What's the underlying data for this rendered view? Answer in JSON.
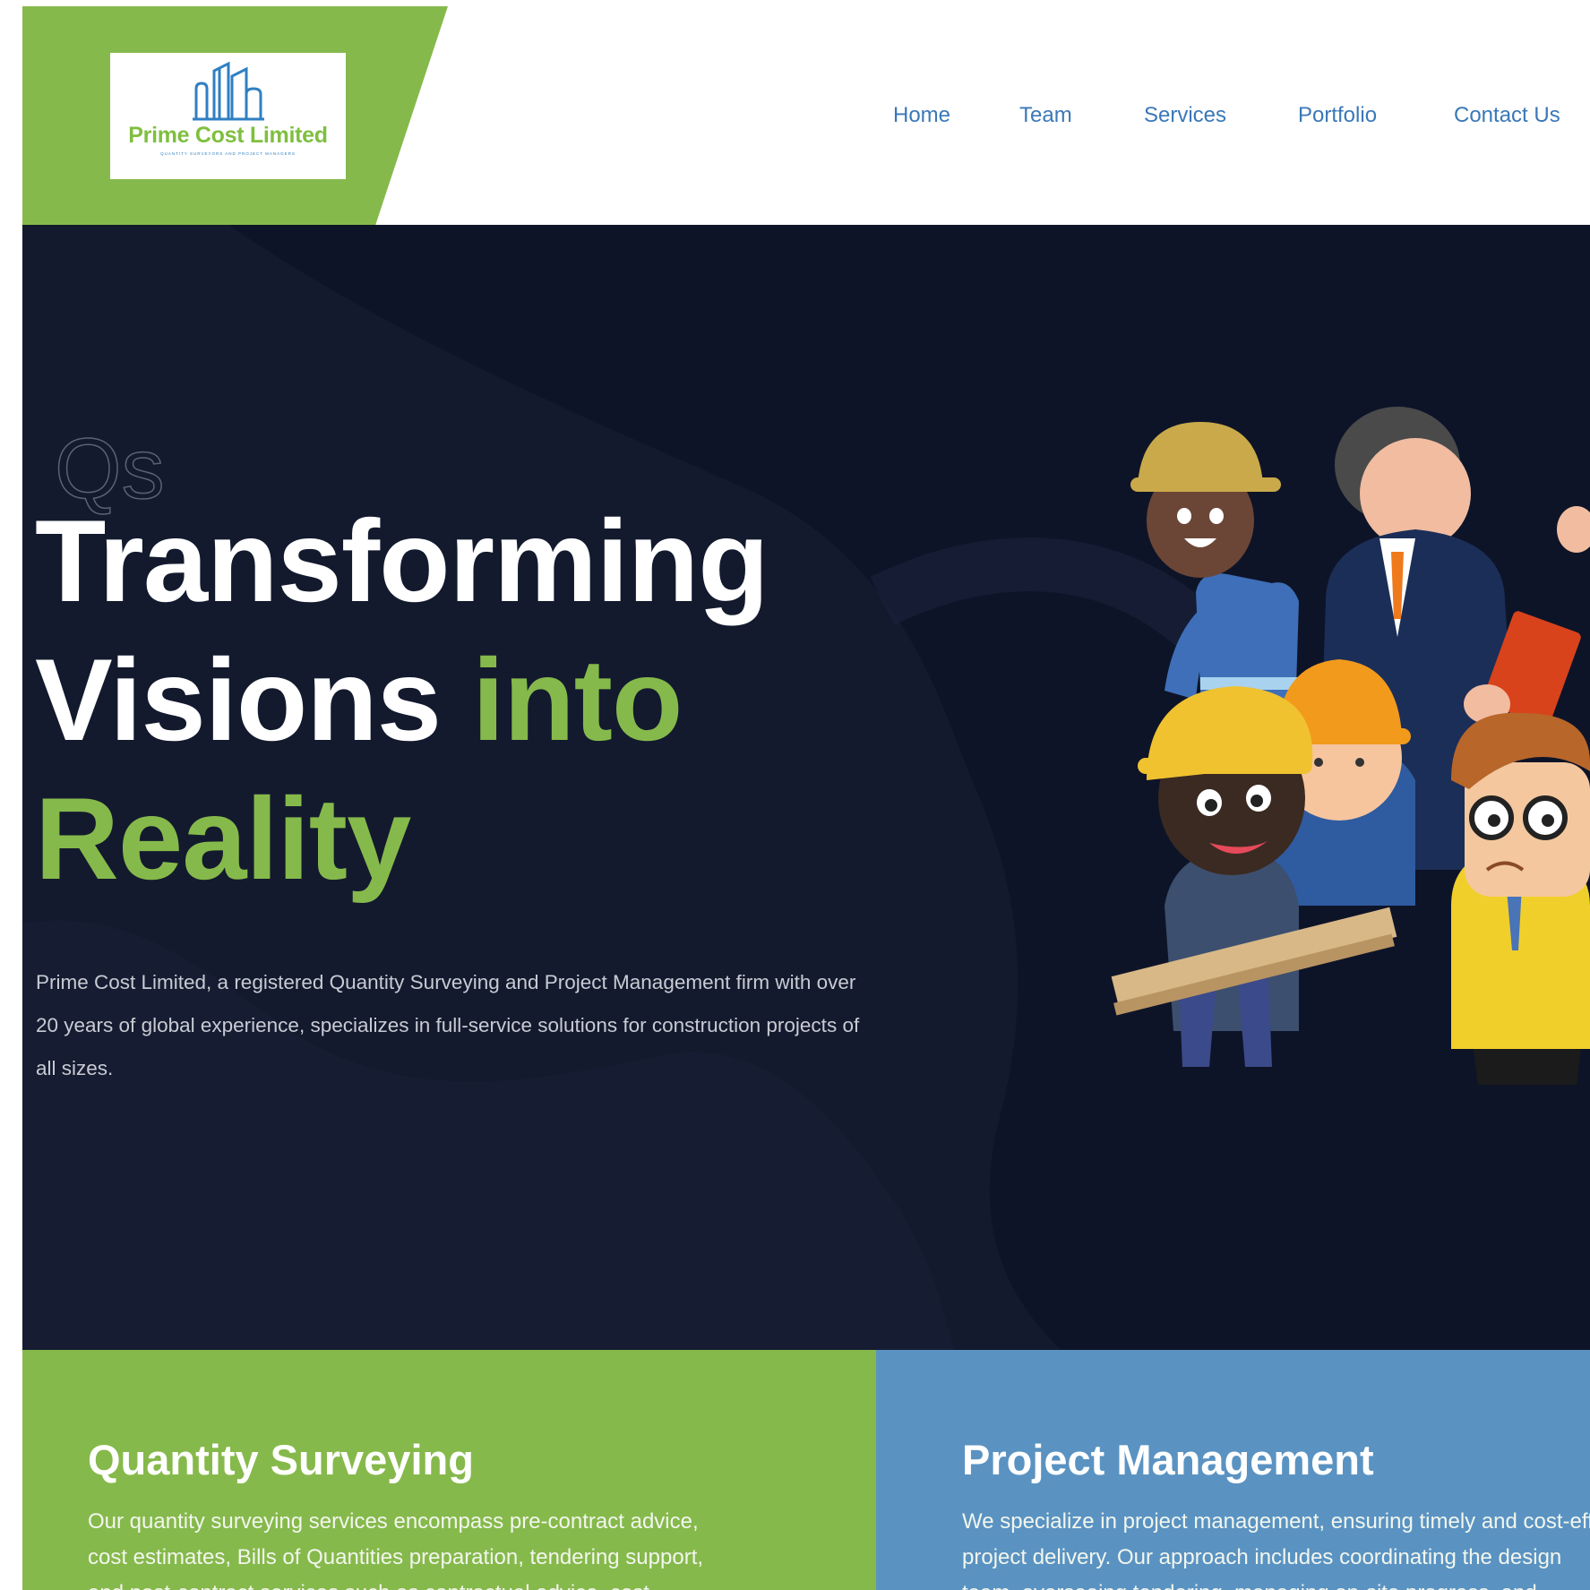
{
  "brand": {
    "name": "Prime Cost Limited",
    "tagline": "QUANTITY SURVEYORS AND PROJECT MANAGERS",
    "logo_icon": "buildings-outline-icon",
    "colors": {
      "green": "#86b94b",
      "navy": "#131a2e",
      "blue": "#5a93c2",
      "nav": "#3a78b8"
    }
  },
  "nav": {
    "items": [
      {
        "label": "Home"
      },
      {
        "label": "Team"
      },
      {
        "label": "Services"
      },
      {
        "label": "Portfolio"
      },
      {
        "label": "Contact Us"
      }
    ]
  },
  "hero": {
    "kicker": "Qs",
    "title_line1": "Transforming",
    "title_line2_white": "Visions",
    "title_line2_green": "into",
    "title_line3": "Reality",
    "description": "Prime Cost Limited, a registered Quantity Surveying and Project Management firm with over 20 years of global experience, specializes in full-service solutions for construction projects of all sizes.",
    "illustration": "construction-team-illustration"
  },
  "services": [
    {
      "title": "Quantity Surveying",
      "line1": "Our quantity surveying services encompass pre-contract advice,",
      "line2": "cost estimates, Bills of Quantities preparation, tendering support,",
      "line3": "and post-contract services such as contractual advice, cost"
    },
    {
      "title": "Project Management",
      "line1": "We specialize in project management, ensuring timely and cost-effective",
      "line2": "project delivery. Our approach includes coordinating the design",
      "line3": "team, overseeing tendering, managing on-site progress, and"
    }
  ]
}
